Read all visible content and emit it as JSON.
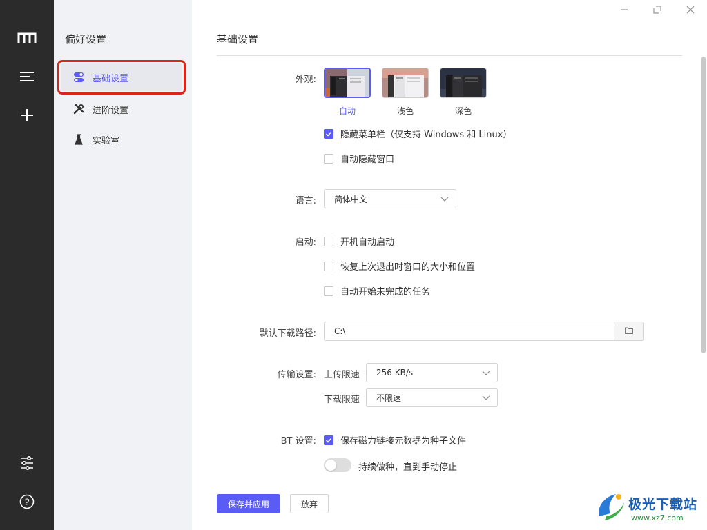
{
  "sidebar": {
    "title": "偏好设置",
    "items": [
      {
        "label": "基础设置",
        "icon": "toggle-icon"
      },
      {
        "label": "进阶设置",
        "icon": "tools-icon"
      },
      {
        "label": "实验室",
        "icon": "flask-icon"
      }
    ]
  },
  "main": {
    "title": "基础设置",
    "appearance": {
      "label": "外观:",
      "themes": [
        {
          "label": "自动",
          "selected": true
        },
        {
          "label": "浅色",
          "selected": false
        },
        {
          "label": "深色",
          "selected": false
        }
      ],
      "hide_menubar": {
        "label": "隐藏菜单栏（仅支持 Windows 和 Linux）",
        "checked": true
      },
      "auto_hide_window": {
        "label": "自动隐藏窗口",
        "checked": false
      }
    },
    "language": {
      "label": "语言:",
      "value": "简体中文"
    },
    "startup": {
      "label": "启动:",
      "options": [
        {
          "label": "开机自动启动",
          "checked": false
        },
        {
          "label": "恢复上次退出时窗口的大小和位置",
          "checked": false
        },
        {
          "label": "自动开始未完成的任务",
          "checked": false
        }
      ]
    },
    "download_path": {
      "label": "默认下载路径:",
      "value": "C:\\"
    },
    "transfer": {
      "label": "传输设置:",
      "upload_label": "上传限速",
      "upload_value": "256 KB/s",
      "download_label": "下载限速",
      "download_value": "不限速"
    },
    "bt": {
      "label": "BT 设置:",
      "save_magnet": {
        "label": "保存磁力链接元数据为种子文件",
        "checked": true
      },
      "keep_seeding": {
        "label": "持续做种，直到手动停止",
        "on": false
      }
    },
    "buttons": {
      "save": "保存并应用",
      "discard": "放弃"
    }
  },
  "watermark": {
    "brand": "极光下载站",
    "url": "www.xz7.com"
  },
  "colors": {
    "accent": "#5b5bf5",
    "rail": "#2b2b2b",
    "sidebar": "#f1f2f5",
    "highlight": "#d9261c"
  }
}
